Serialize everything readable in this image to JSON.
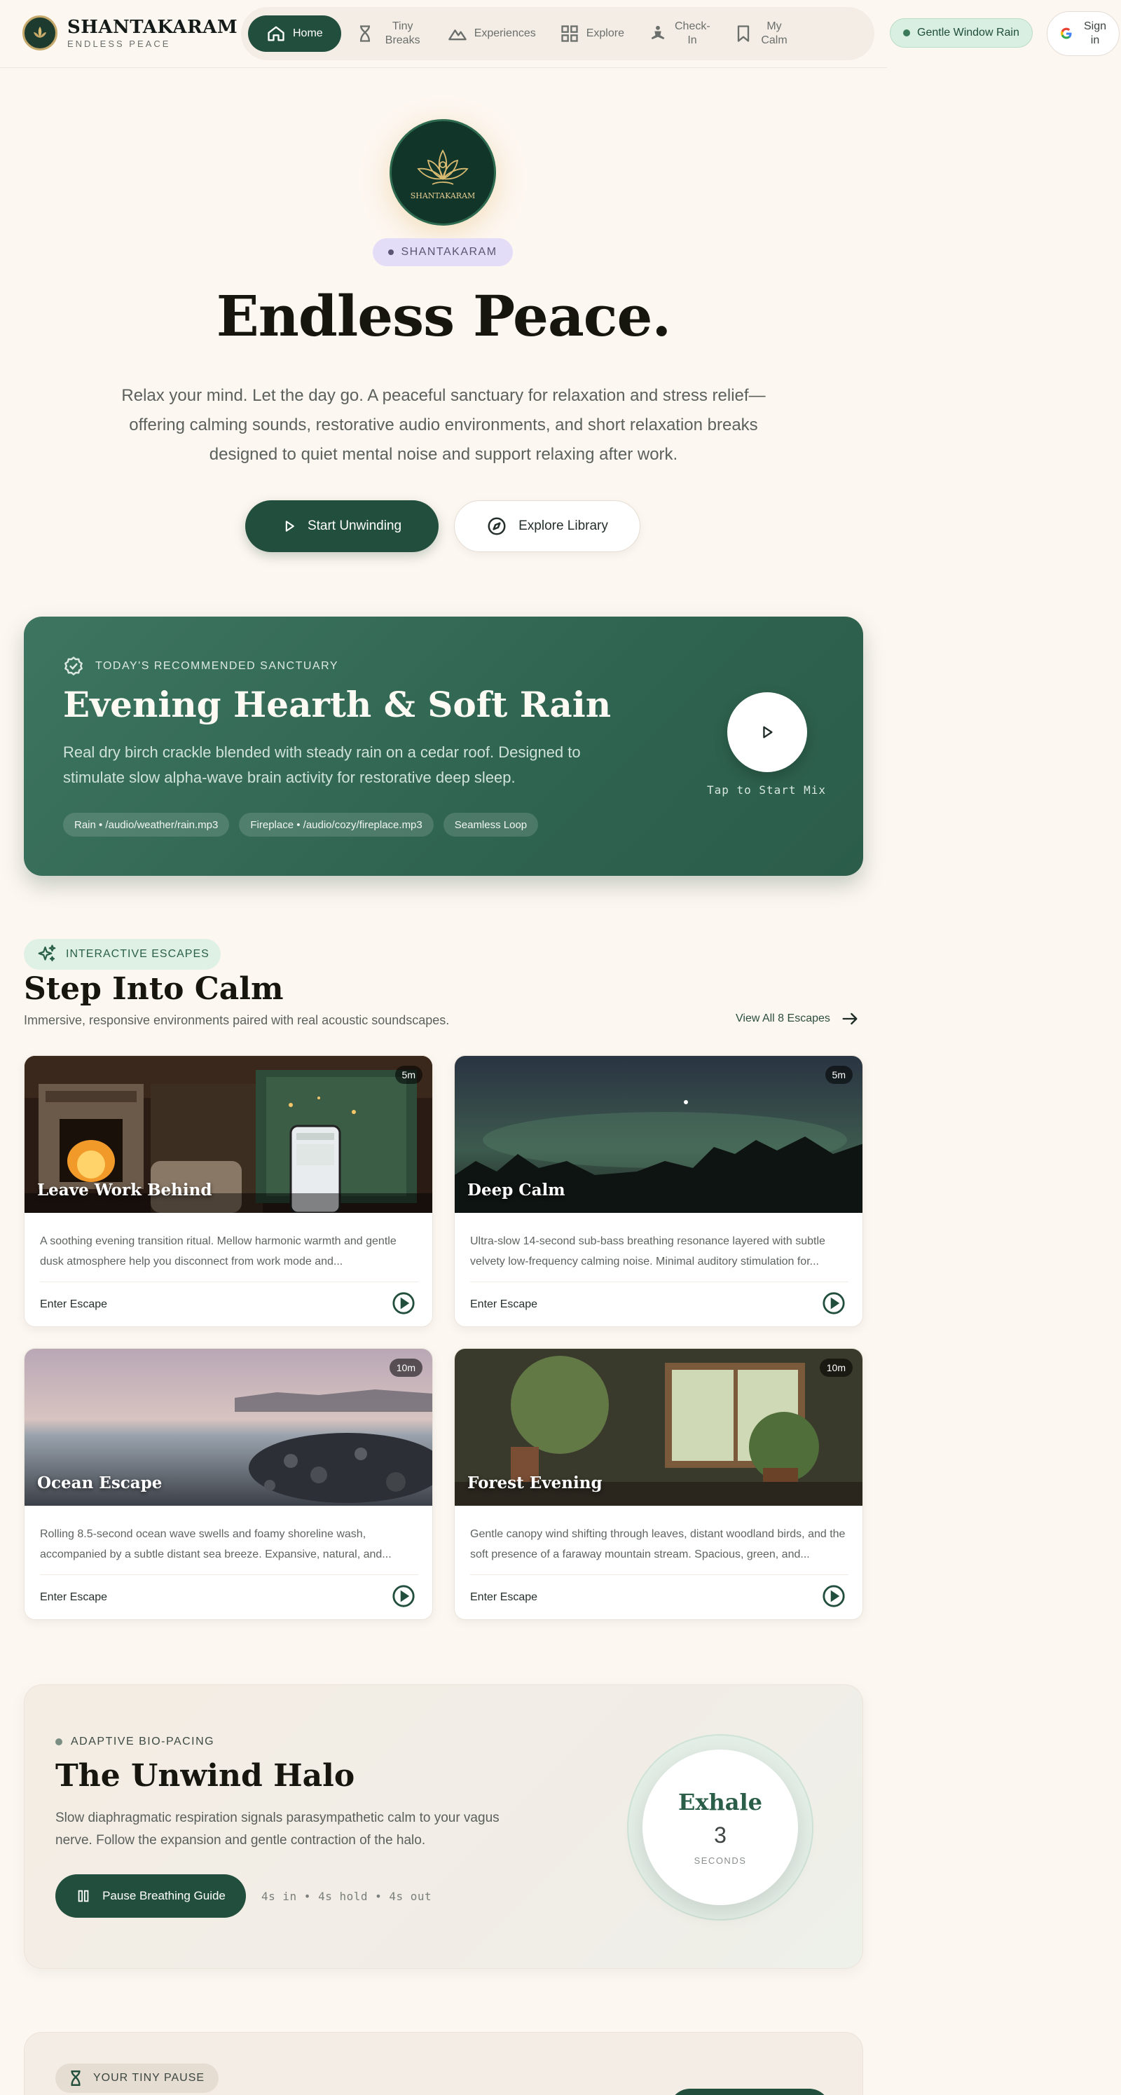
{
  "brand": {
    "name": "SHANTAKARAM",
    "subtitle": "ENDLESS PEACE"
  },
  "nav": {
    "items": [
      {
        "label": "Home",
        "icon": "home-icon",
        "active": true
      },
      {
        "label": "Tiny Breaks",
        "icon": "hourglass-icon"
      },
      {
        "label": "Experiences",
        "icon": "mountain-icon"
      },
      {
        "label": "Explore",
        "icon": "grid-icon"
      },
      {
        "label": "Check-In",
        "icon": "meditation-icon"
      },
      {
        "label": "My Calm",
        "icon": "bookmark-icon"
      }
    ]
  },
  "now_playing": {
    "label": "Gentle Window Rain"
  },
  "auth": {
    "signin_label": "Sign in"
  },
  "hero": {
    "seal_text": "SHANTAKARAM",
    "badge": "SHANTAKARAM",
    "title": "Endless Peace.",
    "description": "Relax your mind. Let the day go. A peaceful sanctuary for relaxation and stress relief—offering calming sounds, restorative audio environments, and short relaxation breaks designed to quiet mental noise and support relaxing after work.",
    "primary_cta": "Start Unwinding",
    "secondary_cta": "Explore Library"
  },
  "recommended": {
    "kicker": "TODAY'S RECOMMENDED SANCTUARY",
    "title": "Evening Hearth & Soft Rain",
    "description": "Real dry birch crackle blended with steady rain on a cedar roof. Designed to stimulate slow alpha-wave brain activity for restorative deep sleep.",
    "tags": [
      "Rain • /audio/weather/rain.mp3",
      "Fireplace • /audio/cozy/fireplace.mp3",
      "Seamless Loop"
    ],
    "play_label": "Tap to Start Mix"
  },
  "escapes": {
    "badge": "INTERACTIVE ESCAPES",
    "title": "Step Into Calm",
    "subtitle": "Immersive, responsive environments paired with real acoustic soundscapes.",
    "view_all": "View All 8 Escapes",
    "enter_label": "Enter Escape",
    "cards": [
      {
        "title": "Leave Work Behind",
        "duration": "5m",
        "description": "A soothing evening transition ritual. Mellow harmonic warmth and gentle dusk atmosphere help you disconnect from work mode and...",
        "enter": "Enter Escape"
      },
      {
        "title": "Deep Calm",
        "duration": "5m",
        "description": "Ultra-slow 14-second sub-bass breathing resonance layered with subtle velvety low-frequency calming noise. Minimal auditory stimulation for...",
        "enter": "Enter Escape"
      },
      {
        "title": "Ocean Escape",
        "duration": "10m",
        "description": "Rolling 8.5-second ocean wave swells and foamy shoreline wash, accompanied by a subtle distant sea breeze. Expansive, natural, and...",
        "enter": "Enter Escape"
      },
      {
        "title": "Forest Evening",
        "duration": "10m",
        "description": "Gentle canopy wind shifting through leaves, distant woodland birds, and the soft presence of a faraway mountain stream. Spacious, green, and...",
        "enter": "Enter Escape"
      }
    ]
  },
  "halo": {
    "kicker": "ADAPTIVE BIO-PACING",
    "title": "The Unwind Halo",
    "description": "Slow diaphragmatic respiration signals parasympathetic calm to your vagus nerve. Follow the expansion and gentle contraction of the halo.",
    "button": "Pause Breathing Guide",
    "timing": "4s in • 4s hold • 4s out",
    "phase": "Exhale",
    "count": "3",
    "unit": "SECONDS"
  },
  "tiny_pause": {
    "badge": "YOUR TINY PAUSE"
  },
  "colors": {
    "accent": "#224f3d",
    "background": "#fdf7f1",
    "recommended_card": "#2f6450",
    "mint_badge": "#d9efe2",
    "lavender_badge": "#e3ddf7"
  }
}
